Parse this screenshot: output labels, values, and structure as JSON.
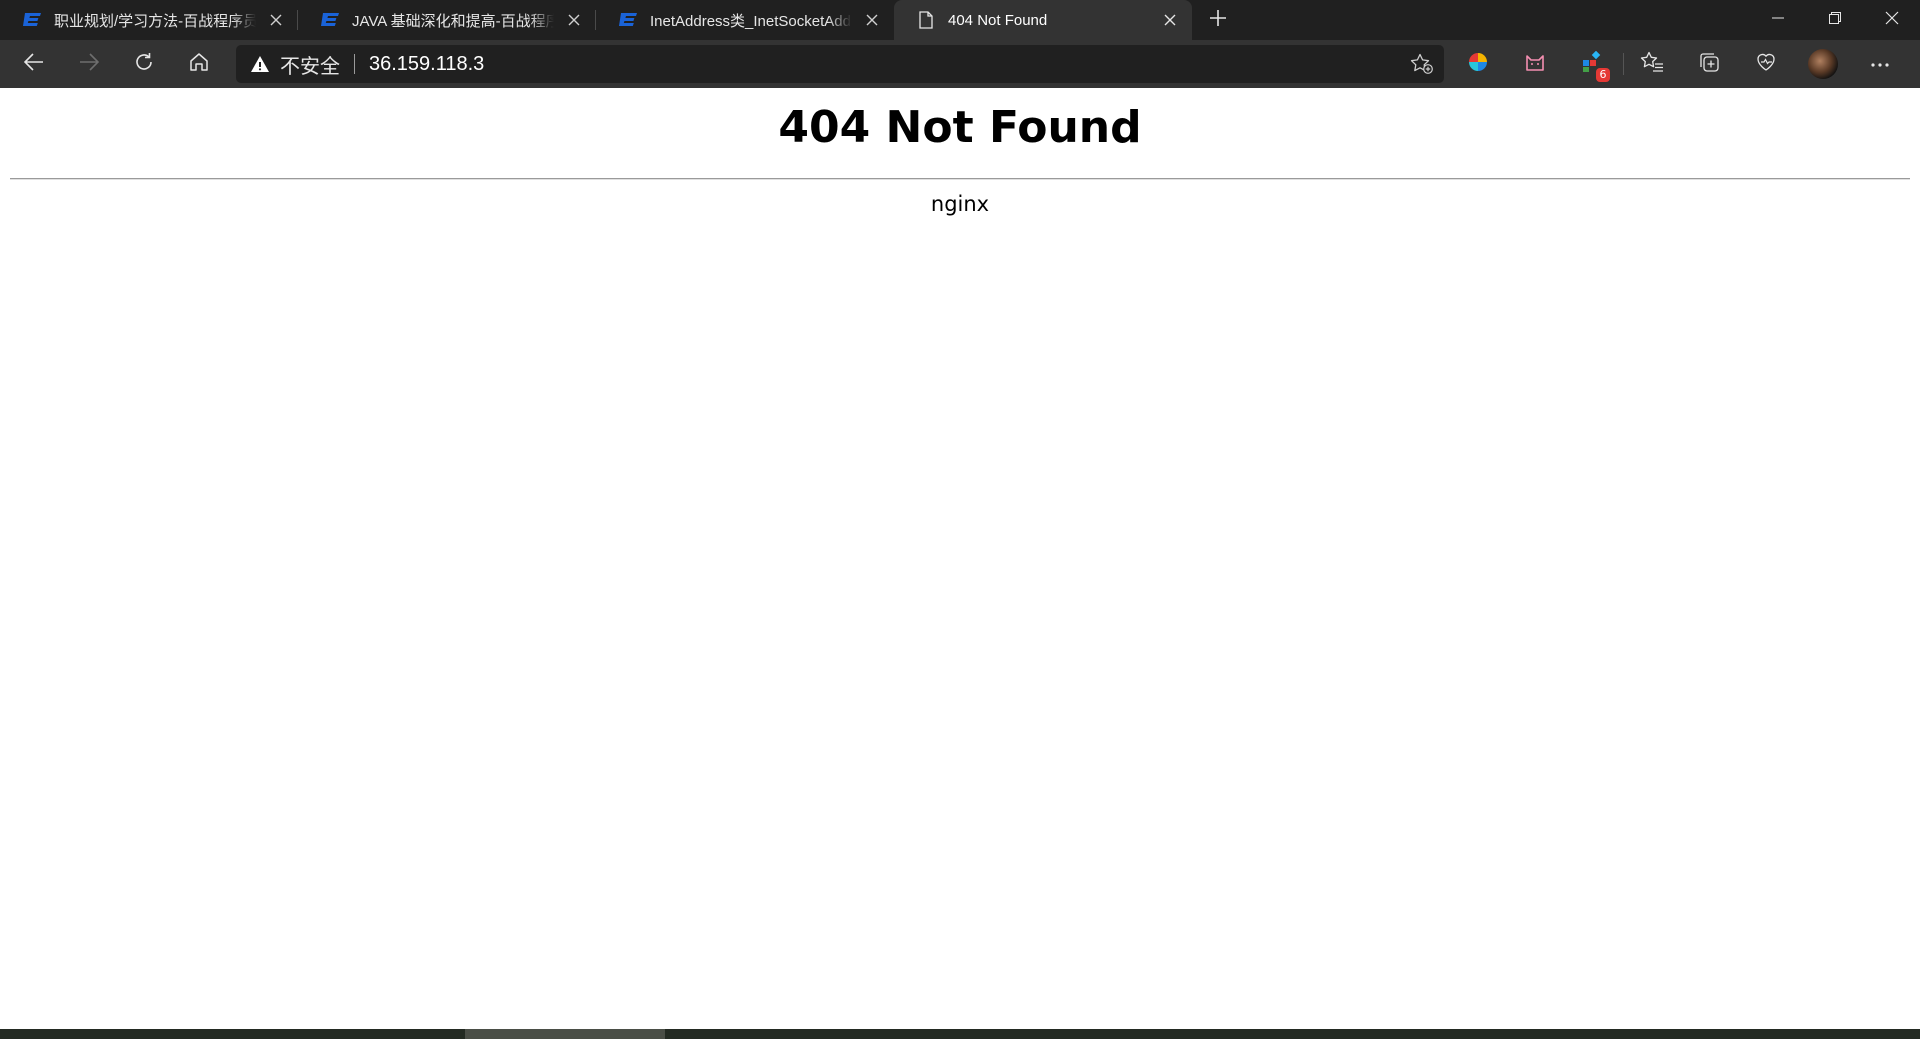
{
  "tabs": [
    {
      "title": "职业规划/学习方法-百战程序员",
      "icon": "bz-logo-icon",
      "active": false
    },
    {
      "title": "JAVA 基础深化和提高-百战程序员",
      "icon": "bz-logo-icon",
      "active": false
    },
    {
      "title": "InetAddress类_InetSocketAddress",
      "icon": "bz-logo-icon",
      "active": false
    },
    {
      "title": "404 Not Found",
      "icon": "page-icon",
      "active": true
    }
  ],
  "addressbar": {
    "security_label": "不安全",
    "url": "36.159.118.3"
  },
  "extensions": {
    "badge_count": "6"
  },
  "page": {
    "heading": "404 Not Found",
    "server": "nginx"
  },
  "colors": {
    "tabstrip_bg": "#202020",
    "toolbar_bg": "#333333",
    "brand_blue": "#1a63d8"
  }
}
